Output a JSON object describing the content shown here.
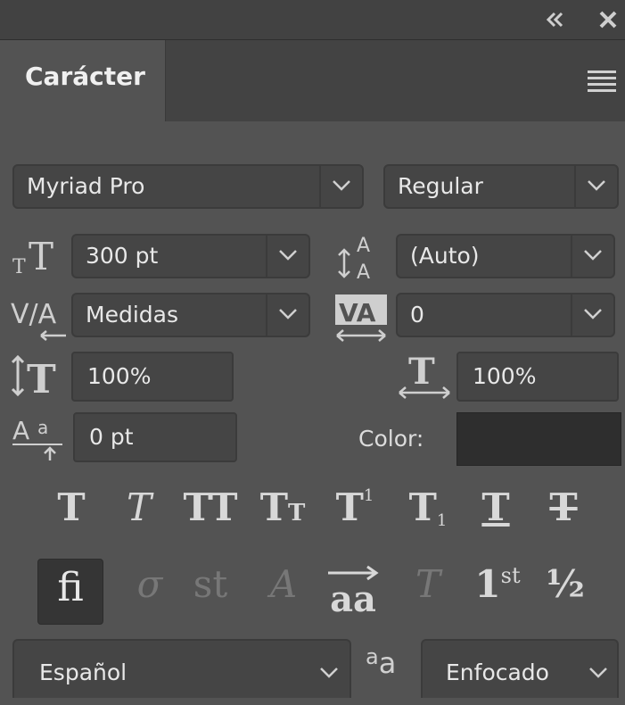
{
  "titlebar": {
    "collapse_icon": "double-chevron-left-icon",
    "close_icon": "close-icon"
  },
  "panel": {
    "tab_title": "Carácter",
    "menu_icon": "hamburger-menu-icon"
  },
  "font": {
    "family": "Myriad Pro",
    "style": "Regular"
  },
  "size": {
    "font_size": "300 pt",
    "leading": "(Auto)"
  },
  "spacing": {
    "kerning": "Medidas",
    "tracking": "0"
  },
  "scale": {
    "vertical": "100%",
    "horizontal": "100%"
  },
  "baseline": {
    "shift": "0 pt",
    "color_label": "Color:"
  },
  "type_styles": {
    "bold": "T",
    "italic": "T",
    "all_caps": "TT",
    "small_caps_big": "T",
    "small_caps_small": "T",
    "super_base": "T",
    "super_sup": "1",
    "sub_base": "T",
    "sub_sub": "1",
    "underline": "T",
    "strike": "T"
  },
  "opentype": {
    "ligatures": "fi",
    "discretionary": "σ",
    "old_style": "st",
    "swash": "A",
    "titling": "aa",
    "ordinal_base": "1",
    "ordinal_sup": "st",
    "fraction": "½"
  },
  "bottom": {
    "language": "Español",
    "aa_label_a1": "a",
    "aa_label_a2": "a",
    "antialias": "Enfocado"
  }
}
